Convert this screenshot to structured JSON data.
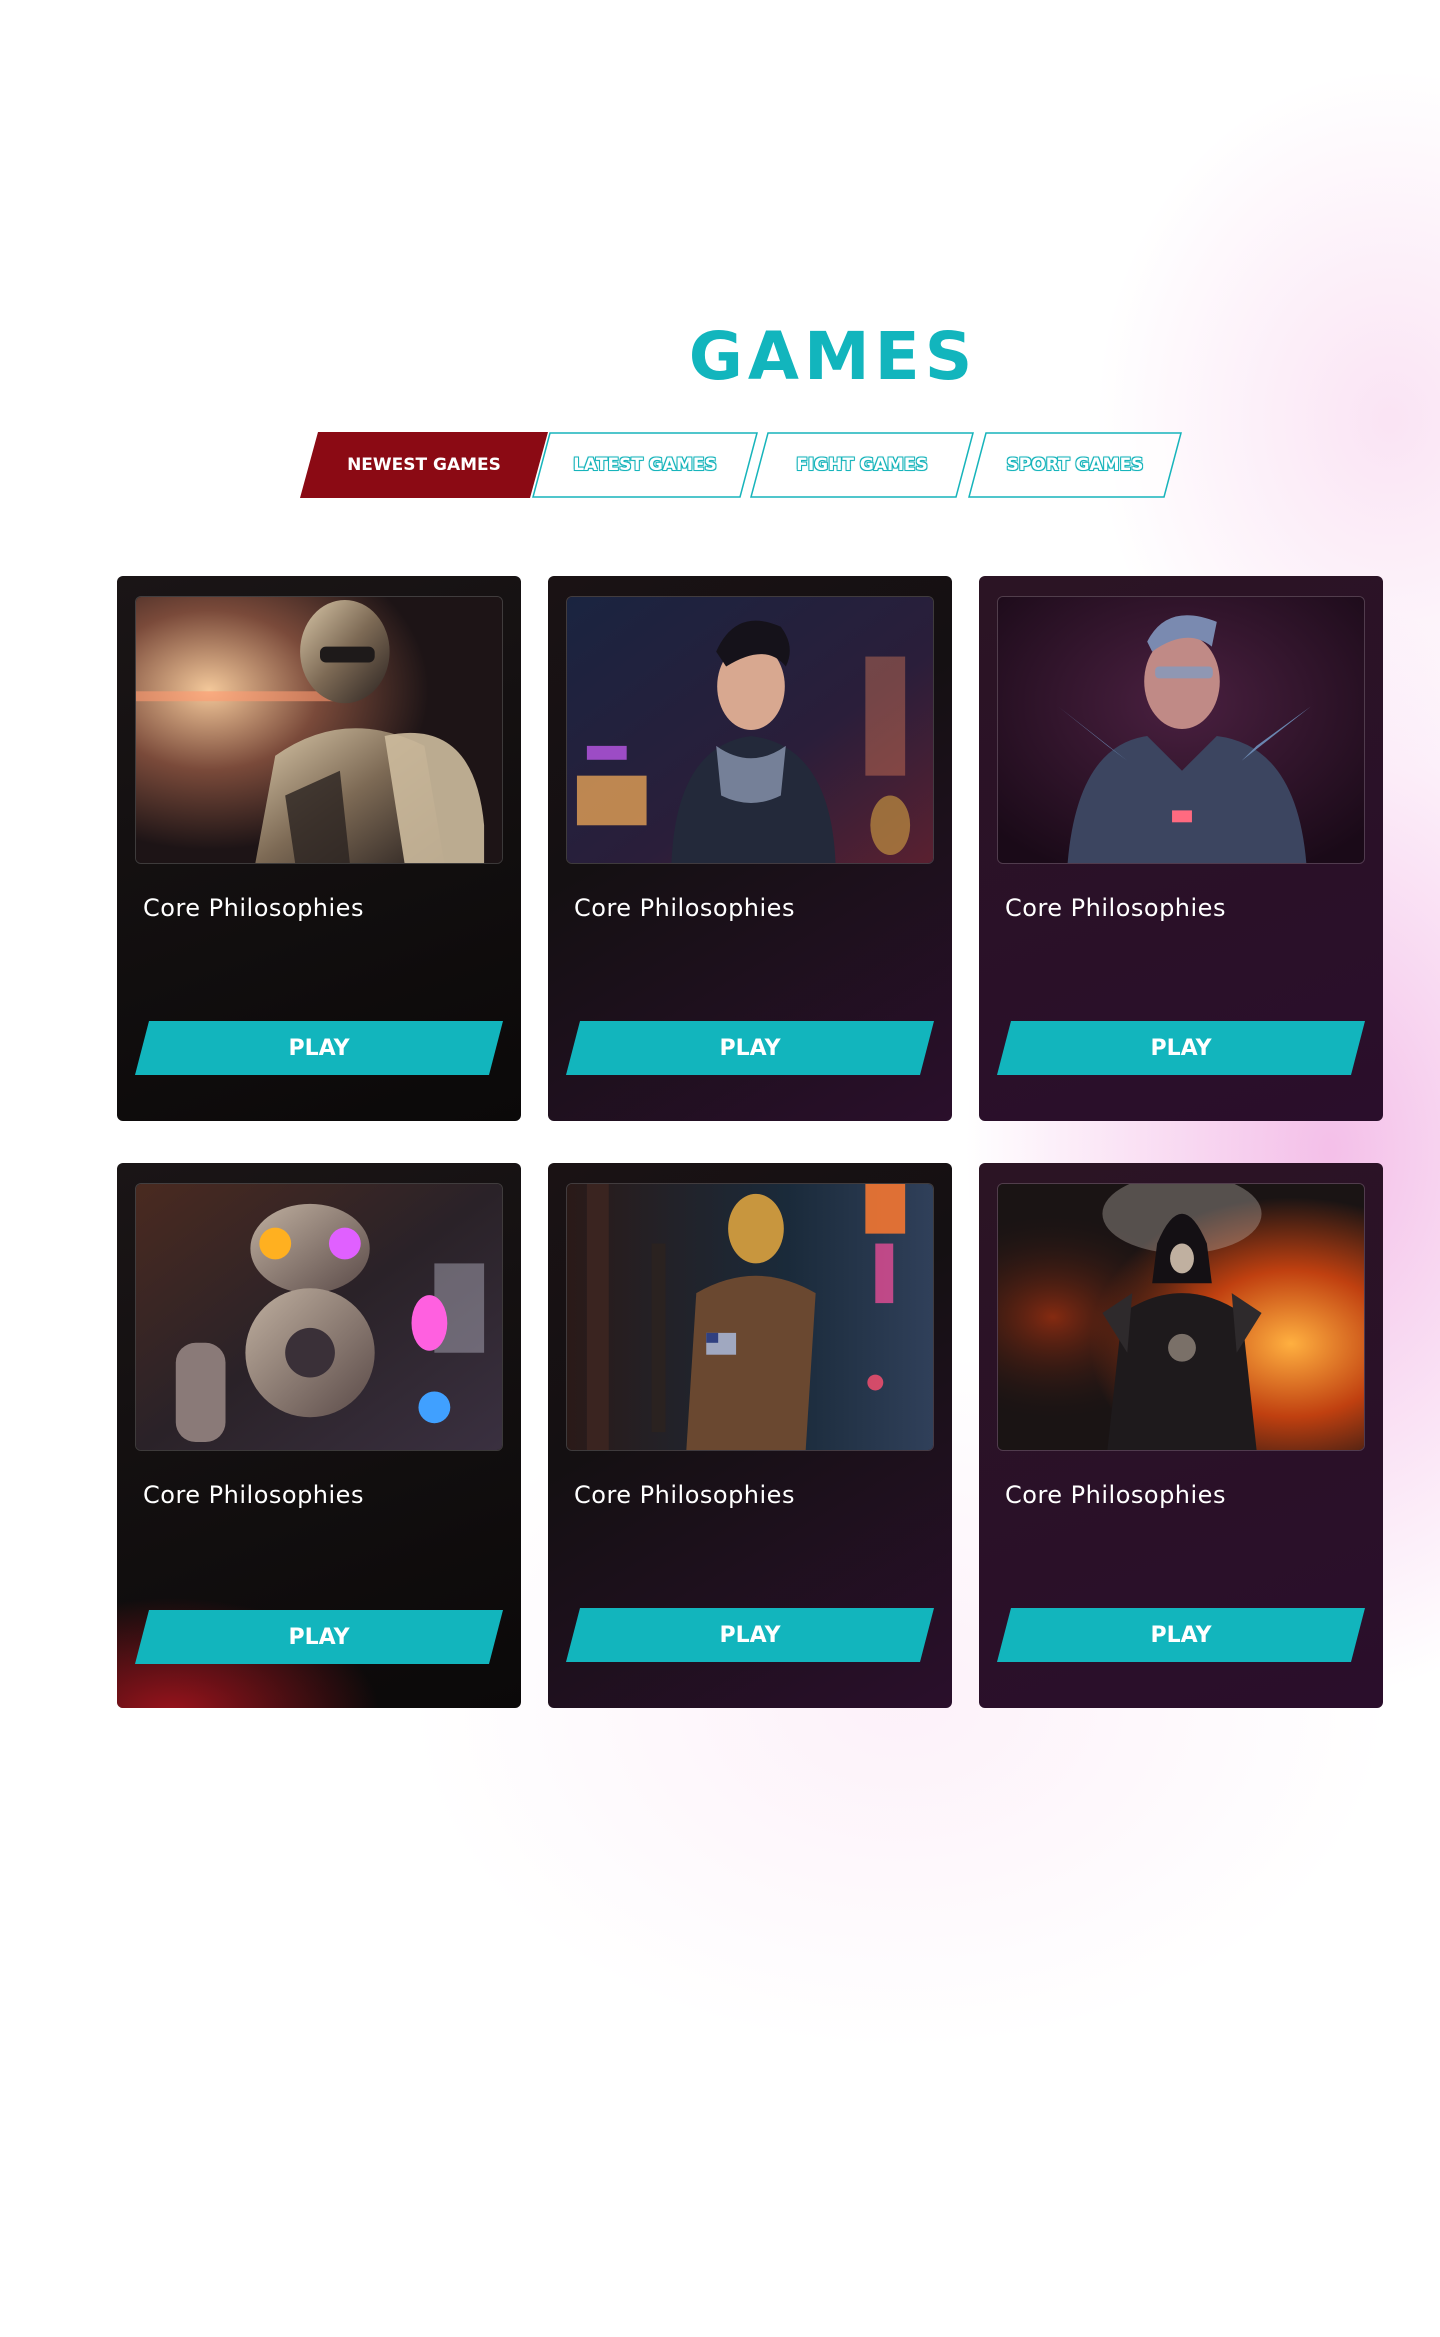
{
  "section": {
    "title": "GAMES"
  },
  "tabs": [
    {
      "label": "NEWEST GAMES"
    },
    {
      "label": "LATEST GAMES"
    },
    {
      "label": "FIGHT GAMES"
    },
    {
      "label": "SPORT GAMES"
    }
  ],
  "cards": [
    {
      "title": "Core Philosophies",
      "play_label": "PLAY",
      "image": "golden-robot-image"
    },
    {
      "title": "Core Philosophies",
      "play_label": "PLAY",
      "image": "cyberpunk-woman-image"
    },
    {
      "title": "Core Philosophies",
      "play_label": "PLAY",
      "image": "armored-warrior-image"
    },
    {
      "title": "Core Philosophies",
      "play_label": "PLAY",
      "image": "neon-robot-image"
    },
    {
      "title": "Core Philosophies",
      "play_label": "PLAY",
      "image": "leopard-soldier-image"
    },
    {
      "title": "Core Philosophies",
      "play_label": "PLAY",
      "image": "dark-knight-image"
    }
  ],
  "colors": {
    "accent": "#12b5bd",
    "active_tab": "#8b0a14",
    "card_bg": "#141012",
    "card_bg_plum": "#2a0e2b"
  }
}
